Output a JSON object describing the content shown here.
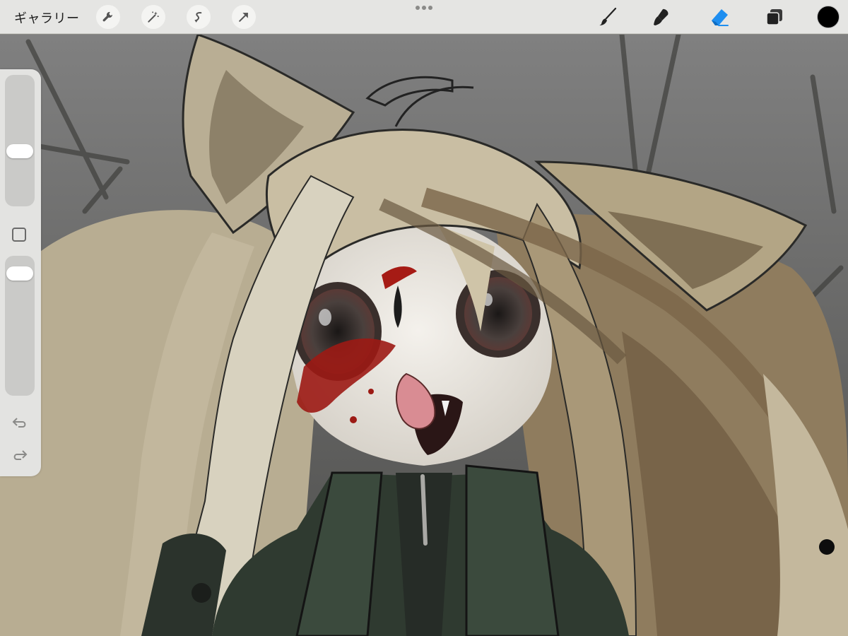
{
  "toolbar": {
    "gallery_label": "ギャラリー",
    "left_tools": [
      "wrench-icon",
      "magic-wand-icon",
      "selection-icon",
      "transform-arrow-icon"
    ],
    "right_tools": [
      "brush-icon",
      "smudge-icon",
      "eraser-icon",
      "layers-icon"
    ],
    "active_tool": "eraser",
    "accent_color": "#1e8ef0",
    "current_color": "#000000"
  },
  "sidebar": {
    "brush_size_level": 0.36,
    "opacity_level": 0.88
  }
}
